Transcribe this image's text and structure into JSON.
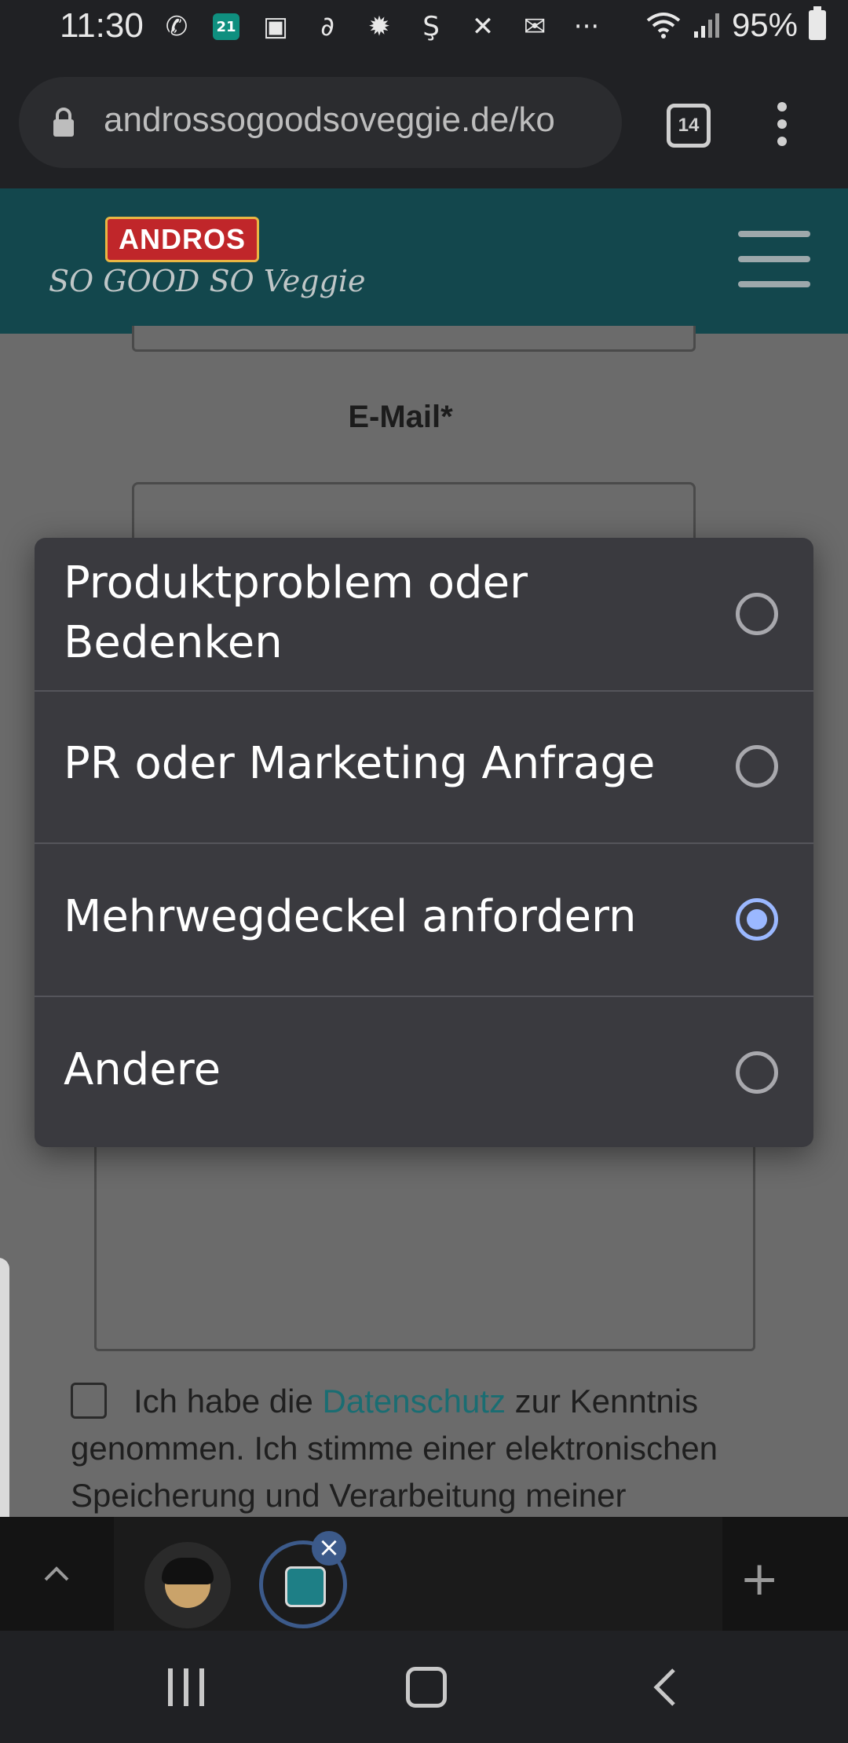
{
  "status_bar": {
    "time": "11:30",
    "calendar_day": "21",
    "battery_percent": "95%",
    "overflow_glyph": "···"
  },
  "browser": {
    "url": "androssogoodsoveggie.de/ko",
    "tab_count": "14"
  },
  "site": {
    "logo_brand": "ANDROS",
    "logo_tagline": "SO GOOD SO Veggie"
  },
  "form": {
    "email_label": "E-Mail*",
    "consent_prefix": "Ich habe die ",
    "consent_link": "Datenschutz",
    "consent_suffix": " zur Kenntnis genommen. Ich stimme einer elektronischen Speicherung und Verarbeitung meiner"
  },
  "dialog": {
    "options": [
      {
        "label": "Produktproblem oder Bedenken",
        "selected": false
      },
      {
        "label": "PR oder Marketing Anfrage",
        "selected": false
      },
      {
        "label": "Mehrwegdeckel anfordern",
        "selected": true
      },
      {
        "label": "Andere",
        "selected": false
      }
    ],
    "accent_color": "#9bb8ff"
  },
  "colors": {
    "header_bg": "#13474d",
    "link": "#1a6d72"
  }
}
